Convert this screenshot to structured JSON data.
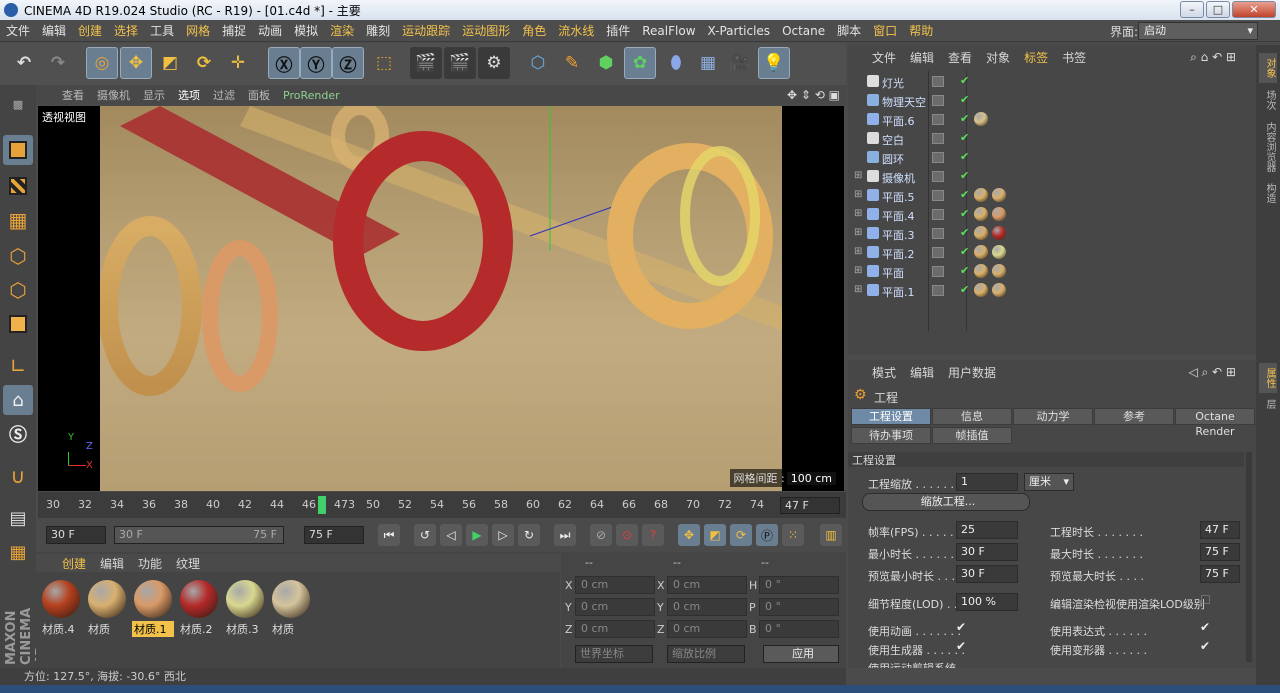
{
  "window": {
    "title": "CINEMA 4D R19.024 Studio (RC - R19) - [01.c4d *] - 主要"
  },
  "menubar": {
    "items": [
      "文件",
      "编辑",
      "创建",
      "选择",
      "工具",
      "网格",
      "捕捉",
      "动画",
      "模拟",
      "渲染",
      "雕刻",
      "运动跟踪",
      "运动图形",
      "角色",
      "流水线",
      "插件",
      "RealFlow",
      "X-Particles",
      "Octane",
      "脚本",
      "窗口",
      "帮助"
    ],
    "layout_label": "界面:",
    "layout_value": "启动"
  },
  "viewport": {
    "menu": [
      "查看",
      "摄像机",
      "显示",
      "选项",
      "过滤",
      "面板",
      "ProRender"
    ],
    "label": "透视视图",
    "grid_label": "网格间距 :",
    "grid_value": "100 cm"
  },
  "timeline": {
    "ticks": [
      "30",
      "32",
      "34",
      "36",
      "38",
      "40",
      "42",
      "44",
      "46",
      "473",
      "50",
      "52",
      "54",
      "56",
      "58",
      "60",
      "62",
      "64",
      "66",
      "68",
      "70",
      "72",
      "74"
    ],
    "end_frame": "47 F",
    "start_field": "30 F",
    "range_left": "30 F",
    "range_right": "75 F",
    "max_field": "75 F"
  },
  "materials": {
    "tabs": [
      "创建",
      "编辑",
      "功能",
      "纹理"
    ],
    "items": [
      {
        "name": "材质.4",
        "color": "#b5401e"
      },
      {
        "name": "材质",
        "color": "#d8b070"
      },
      {
        "name": "材质.1",
        "color": "#d99a68"
      },
      {
        "name": "材质.2",
        "color": "#b52a2a"
      },
      {
        "name": "材质.3",
        "color": "#d9d890"
      },
      {
        "name": "材质",
        "color": "#d4c49c"
      }
    ]
  },
  "coords": {
    "header1": "--",
    "header2": "--",
    "header3": "--",
    "rows": [
      {
        "a": "X",
        "av": "0 cm",
        "b": "X",
        "bv": "0 cm",
        "c": "H",
        "cv": "0 °"
      },
      {
        "a": "Y",
        "av": "0 cm",
        "b": "Y",
        "bv": "0 cm",
        "c": "P",
        "cv": "0 °"
      },
      {
        "a": "Z",
        "av": "0 cm",
        "b": "Z",
        "bv": "0 cm",
        "c": "B",
        "cv": "0 °"
      }
    ],
    "world": "世界坐标",
    "scale": "缩放比例",
    "apply": "应用"
  },
  "status": "方位: 127.5°, 海拔: -30.6° 西北",
  "objects": {
    "menu": [
      "文件",
      "编辑",
      "查看",
      "对象",
      "标签",
      "书签"
    ],
    "rows": [
      {
        "name": "灯光",
        "tags": []
      },
      {
        "name": "物理天空",
        "tags": []
      },
      {
        "name": "平面.6",
        "tags": [
          "#d9c08a"
        ]
      },
      {
        "name": "空白",
        "tags": []
      },
      {
        "name": "圆环",
        "tags": []
      },
      {
        "name": "摄像机",
        "tags": []
      },
      {
        "name": "平面.5",
        "tags": [
          "#d9b06a",
          "#d8b070"
        ]
      },
      {
        "name": "平面.4",
        "tags": [
          "#d9b06a",
          "#d99a68"
        ]
      },
      {
        "name": "平面.3",
        "tags": [
          "#d9b06a",
          "#b52a2a"
        ]
      },
      {
        "name": "平面.2",
        "tags": [
          "#d9b06a",
          "#d9d890"
        ]
      },
      {
        "name": "平面",
        "tags": [
          "#d9b06a",
          "#d8b070"
        ]
      },
      {
        "name": "平面.1",
        "tags": [
          "#d9b06a",
          "#d8b070"
        ]
      }
    ]
  },
  "attributes": {
    "menu": [
      "模式",
      "编辑",
      "用户数据"
    ],
    "object_title": "工程",
    "tabs_row1": [
      "工程设置",
      "信息",
      "动力学",
      "参考",
      "Octane Render"
    ],
    "tabs_row2": [
      "待办事项",
      "帧插值"
    ],
    "section": "工程设置",
    "scale_label": "工程缩放 . . . . . . .",
    "scale_value": "1",
    "scale_unit": "厘米",
    "scale_button": "缩放工程...",
    "fps_label": "帧率(FPS) . . . . . .",
    "fps_value": "25",
    "length_label": "工程时长 . . . . . . .",
    "length_value": "47 F",
    "min_label": "最小时长 . . . . . .",
    "min_value": "30 F",
    "max_label": "最大时长 . . . . . . .",
    "max_value": "75 F",
    "pmin_label": "预览最小时长 . . .",
    "pmin_value": "30 F",
    "pmax_label": "预览最大时长 . . . .",
    "pmax_value": "75 F",
    "lod_label": "细节程度(LOD) . . .",
    "lod_value": "100 %",
    "lod_check_label": "编辑渲染检视使用渲染LOD级别",
    "anim_label": "使用动画 . . . . . . .",
    "expr_label": "使用表达式 . . . . . .",
    "gen_label": "使用生成器 . . . . . .",
    "deform_label": "使用变形器 . . . . . .",
    "motion_label": "使用运动剪辑系统"
  },
  "rightstrip": {
    "items": [
      "对象",
      "场次",
      "内容浏览器",
      "构造",
      "属性",
      "层"
    ]
  }
}
